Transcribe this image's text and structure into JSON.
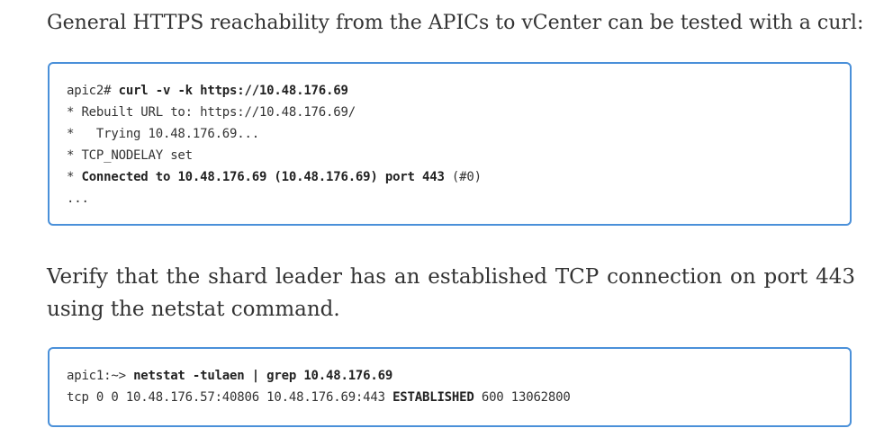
{
  "paragraphs": {
    "intro": "General HTTPS reachability from the APICs to vCenter can be tested with a curl:",
    "verify": "Verify that the shard leader has an established TCP connection on port 443 using the netstat command."
  },
  "code_block_1": {
    "line1_prompt": "apic2# ",
    "line1_cmd": "curl -v -k https://10.48.176.69",
    "line2": "* Rebuilt URL to: https://10.48.176.69/",
    "line3": "*   Trying 10.48.176.69...",
    "line4": "* TCP_NODELAY set",
    "line5_prefix": "* ",
    "line5_bold": "Connected to 10.48.176.69 (10.48.176.69) port 443",
    "line5_suffix": " (#0)",
    "line6": "..."
  },
  "code_block_2": {
    "line1_prompt": "apic1:~> ",
    "line1_cmd": "netstat -tulaen | grep 10.48.176.69",
    "line2_prefix": "tcp 0 0 10.48.176.57:40806 10.48.176.69:443 ",
    "line2_bold": "ESTABLISHED",
    "line2_suffix": " 600 13062800"
  }
}
